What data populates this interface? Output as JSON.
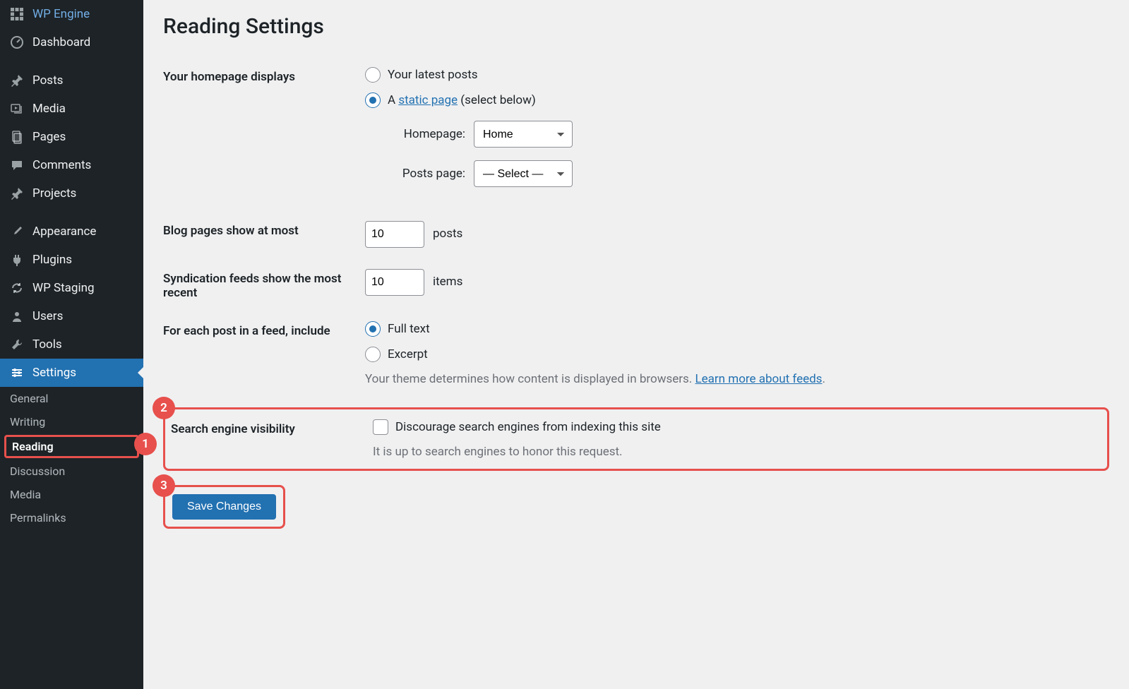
{
  "sidebar": {
    "items": [
      {
        "label": "WP Engine",
        "icon": "wpengine"
      },
      {
        "label": "Dashboard",
        "icon": "dashboard"
      },
      {
        "label": "Posts",
        "icon": "pin"
      },
      {
        "label": "Media",
        "icon": "media"
      },
      {
        "label": "Pages",
        "icon": "pages"
      },
      {
        "label": "Comments",
        "icon": "comments"
      },
      {
        "label": "Projects",
        "icon": "pin"
      },
      {
        "label": "Appearance",
        "icon": "brush"
      },
      {
        "label": "Plugins",
        "icon": "plug"
      },
      {
        "label": "WP Staging",
        "icon": "refresh"
      },
      {
        "label": "Users",
        "icon": "user"
      },
      {
        "label": "Tools",
        "icon": "wrench"
      },
      {
        "label": "Settings",
        "icon": "settings",
        "active": true
      }
    ],
    "submenu": [
      {
        "label": "General"
      },
      {
        "label": "Writing"
      },
      {
        "label": "Reading",
        "current": true
      },
      {
        "label": "Discussion"
      },
      {
        "label": "Media"
      },
      {
        "label": "Permalinks"
      }
    ]
  },
  "page": {
    "title": "Reading Settings",
    "homepage_displays_label": "Your homepage displays",
    "radio_latest": "Your latest posts",
    "radio_static_pre": "A ",
    "radio_static_link": "static page",
    "radio_static_post": " (select below)",
    "homepage_label": "Homepage:",
    "homepage_value": "Home",
    "posts_page_label": "Posts page:",
    "posts_page_value": "— Select —",
    "blog_pages_label": "Blog pages show at most",
    "blog_pages_value": "10",
    "blog_pages_suffix": "posts",
    "syndication_label": "Syndication feeds show the most recent",
    "syndication_value": "10",
    "syndication_suffix": "items",
    "feed_include_label": "For each post in a feed, include",
    "feed_full": "Full text",
    "feed_excerpt": "Excerpt",
    "feed_desc": "Your theme determines how content is displayed in browsers. ",
    "feed_link": "Learn more about feeds",
    "sev_label": "Search engine visibility",
    "sev_checkbox": "Discourage search engines from indexing this site",
    "sev_desc": "It is up to search engines to honor this request.",
    "save_button": "Save Changes"
  },
  "annotations": {
    "b1": "1",
    "b2": "2",
    "b3": "3"
  }
}
